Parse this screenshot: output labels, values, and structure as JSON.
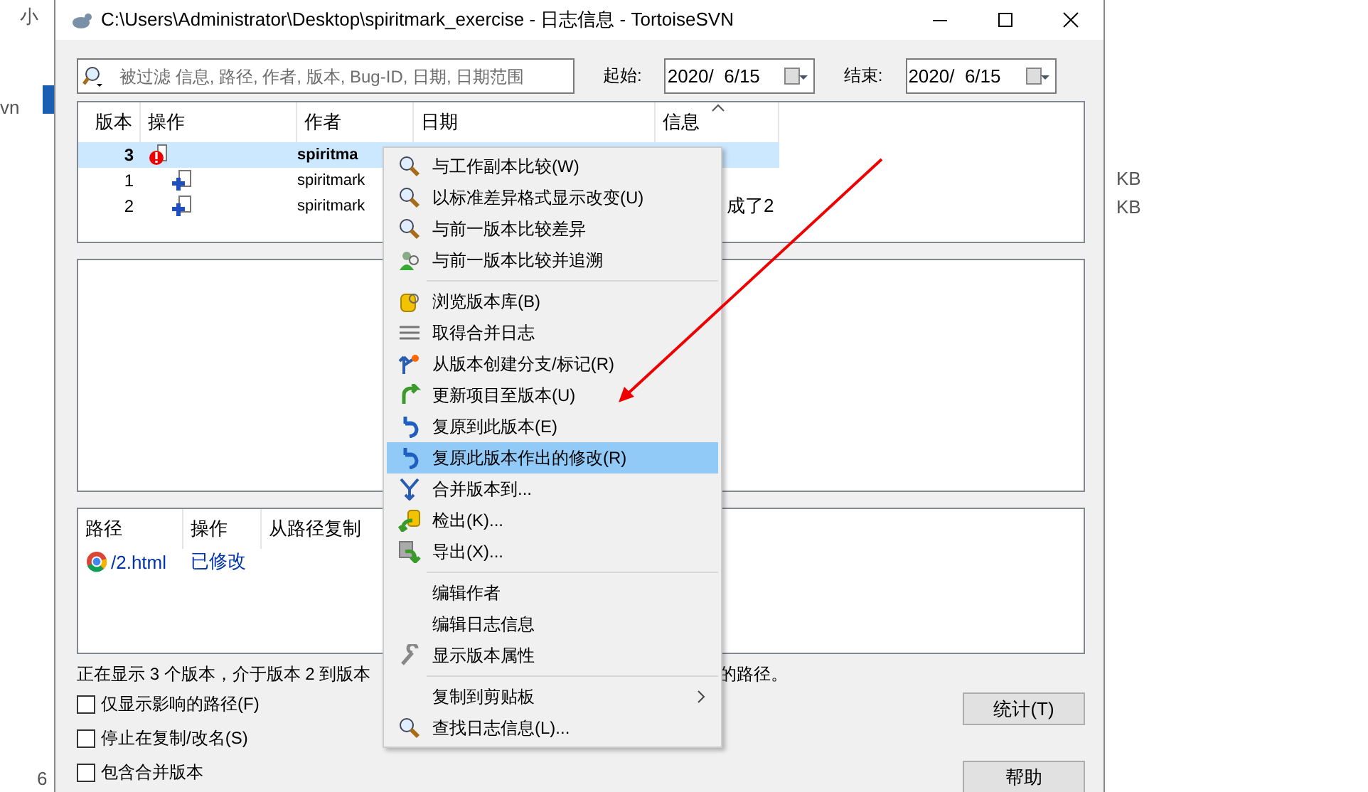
{
  "background": {
    "left_texts": [
      "小",
      "vn",
      "6"
    ],
    "right_texts": [
      "KB",
      "KB"
    ]
  },
  "window": {
    "title": "C:\\Users\\Administrator\\Desktop\\spiritmark_exercise - 日志信息 - TortoiseSVN"
  },
  "filter": {
    "placeholder": "被过滤 信息, 路径, 作者, 版本, Bug-ID, 日期, 日期范围"
  },
  "date_from": {
    "label": "起始:",
    "value": "2020/  6/15"
  },
  "date_to": {
    "label": "结束:",
    "value": "2020/  6/15"
  },
  "log": {
    "columns": [
      "版本",
      "操作",
      "作者",
      "日期",
      "信息"
    ],
    "rows": [
      {
        "revision": "3",
        "kind": "modified",
        "author": "spiritma",
        "current": true,
        "selected": true
      },
      {
        "revision": "1",
        "kind": "added",
        "author": "spiritmark",
        "current": false,
        "selected": false
      },
      {
        "revision": "2",
        "kind": "added",
        "author": "spiritmark",
        "message": "成了2",
        "current": false,
        "selected": false
      }
    ]
  },
  "paths": {
    "columns": [
      "路径",
      "操作",
      "从路径复制"
    ],
    "rows": [
      {
        "path": "/2.html",
        "action": "已修改"
      }
    ]
  },
  "status": {
    "text": "正在显示 3 个版本，介于版本 2 到版本",
    "text_end": "的路径。"
  },
  "checkboxes": [
    {
      "label": "仅显示影响的路径(F)",
      "checked": false
    },
    {
      "label": "停止在复制/改名(S)",
      "checked": false
    },
    {
      "label": "包含合并版本",
      "checked": false
    }
  ],
  "buttons": [
    "统计(T)",
    "帮助"
  ],
  "context_menu": {
    "groups": [
      [
        {
          "label": "与工作副本比较(W)",
          "selected": false,
          "submenu": false
        },
        {
          "label": "以标准差异格式显示改变(U)",
          "selected": false,
          "submenu": false
        },
        {
          "label": "与前一版本比较差异",
          "selected": false,
          "submenu": false
        },
        {
          "label": "与前一版本比较并追溯",
          "selected": false,
          "submenu": false
        }
      ],
      [
        {
          "label": "浏览版本库(B)",
          "selected": false,
          "submenu": false
        },
        {
          "label": "取得合并日志",
          "selected": false,
          "submenu": false
        },
        {
          "label": "从版本创建分支/标记(R)",
          "selected": false,
          "submenu": false
        },
        {
          "label": "更新项目至版本(U)",
          "selected": false,
          "submenu": false
        },
        {
          "label": "复原到此版本(E)",
          "selected": false,
          "submenu": false
        },
        {
          "label": "复原此版本作出的修改(R)",
          "selected": true,
          "submenu": false
        },
        {
          "label": "合并版本到...",
          "selected": false,
          "submenu": false
        },
        {
          "label": "检出(K)...",
          "selected": false,
          "submenu": false
        },
        {
          "label": "导出(X)...",
          "selected": false,
          "submenu": false
        }
      ],
      [
        {
          "label": "编辑作者",
          "selected": false,
          "submenu": false
        },
        {
          "label": "编辑日志信息",
          "selected": false,
          "submenu": false
        },
        {
          "label": "显示版本属性",
          "selected": false,
          "submenu": false
        }
      ],
      [
        {
          "label": "复制到剪贴板",
          "selected": false,
          "submenu": true
        },
        {
          "label": "查找日志信息(L)...",
          "selected": false,
          "submenu": false
        }
      ]
    ]
  }
}
